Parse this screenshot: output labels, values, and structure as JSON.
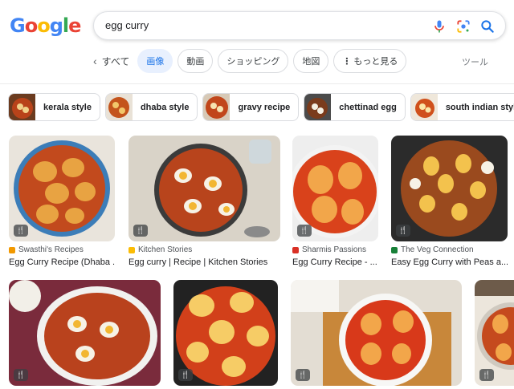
{
  "logo": {
    "letters": [
      "G",
      "o",
      "o",
      "g",
      "l",
      "e"
    ]
  },
  "search": {
    "query": "egg curry"
  },
  "tabs": {
    "back_label": "すべて",
    "items": [
      "画像",
      "動画",
      "ショッピング",
      "地図",
      "もっと見る"
    ],
    "tools_label": "ツール"
  },
  "chips": [
    "kerala style",
    "dhaba style",
    "gravy recipe",
    "chettinad egg",
    "south indian style"
  ],
  "results": [
    {
      "source": "Swasthi's Recipes",
      "title": "Egg Curry Recipe (Dhaba ...",
      "favicon_color": "#f29900"
    },
    {
      "source": "Kitchen Stories",
      "title": "Egg curry | Recipe | Kitchen Stories",
      "favicon_color": "#fbbc05"
    },
    {
      "source": "Sharmis Passions",
      "title": "Egg Curry Recipe - ...",
      "favicon_color": "#d93025"
    },
    {
      "source": "The Veg Connection",
      "title": "Easy Egg Curry with Peas a...",
      "favicon_color": "#188038"
    }
  ],
  "badge_icon": "fork-knife-icon",
  "colors": {
    "accent": "#1a73e8",
    "active_tab_bg": "#e8f0fe",
    "curry": "#c8441a"
  }
}
